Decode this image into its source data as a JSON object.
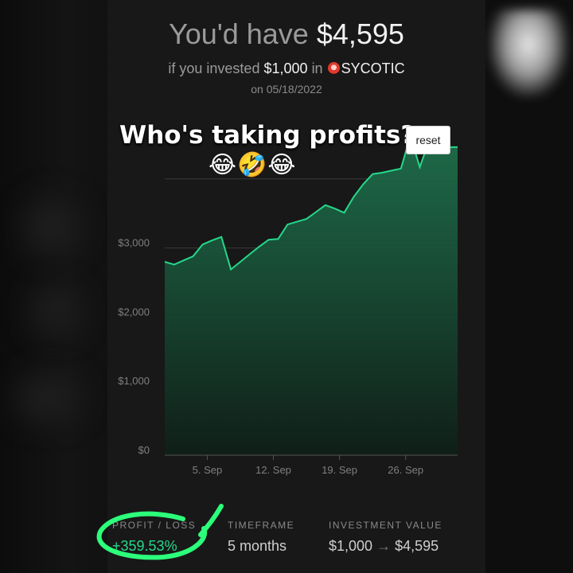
{
  "header": {
    "prefix": "You'd have",
    "amount": "$4,595",
    "sub_prefix": "if you invested",
    "invested": "$1,000",
    "sub_in": "in",
    "ticker": "SYCOTIC",
    "date_prefix": "on",
    "date": "05/18/2022"
  },
  "overlay": {
    "caption": "Who's taking profits?",
    "emojis": "😂🤣😂"
  },
  "chart_controls": {
    "reset_label": "reset"
  },
  "chart_data": {
    "type": "area",
    "y_ticks": [
      "$0",
      "$1,000",
      "$2,000",
      "$3,000"
    ],
    "x_ticks": [
      "5. Sep",
      "12. Sep",
      "19. Sep",
      "26. Sep"
    ],
    "ylim": [
      0,
      4500
    ],
    "grid": true,
    "color": "#25d88a",
    "x": [
      0,
      1,
      2,
      3,
      4,
      5,
      6,
      7,
      8,
      9,
      10,
      11,
      12,
      13,
      14,
      15,
      16,
      17,
      18,
      19,
      20,
      21,
      22,
      23,
      24,
      25,
      26,
      27,
      28,
      29,
      30,
      31
    ],
    "values": [
      2800,
      2760,
      2820,
      2880,
      3050,
      3110,
      3160,
      2690,
      2800,
      2910,
      3020,
      3120,
      3130,
      3340,
      3380,
      3420,
      3520,
      3620,
      3570,
      3510,
      3740,
      3920,
      4070,
      4090,
      4120,
      4150,
      4620,
      4170,
      4560,
      4700,
      4460,
      4460
    ]
  },
  "stats": {
    "profit_label": "PROFIT / LOSS",
    "profit_value": "+359.53%",
    "timeframe_label": "TIMEFRAME",
    "timeframe_value": "5 months",
    "investment_label": "INVESTMENT VALUE",
    "investment_from": "$1,000",
    "investment_arrow": "→",
    "investment_to": "$4,595"
  },
  "colors": {
    "accent": "#25d88a",
    "annotation": "#2cff7a"
  }
}
